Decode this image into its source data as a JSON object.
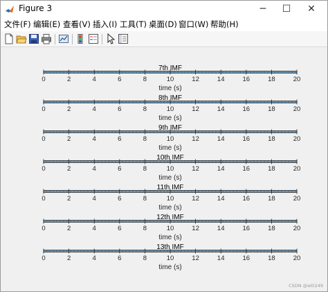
{
  "window": {
    "title": "Figure 3",
    "controls": [
      "─",
      "☐",
      "✕"
    ]
  },
  "menu": [
    "文件(F)",
    "编辑(E)",
    "查看(V)",
    "插入(I)",
    "工具(T)",
    "桌面(D)",
    "窗口(W)",
    "帮助(H)"
  ],
  "toolbar_icons": [
    "new-figure-icon",
    "open-file-icon",
    "save-icon",
    "print-icon",
    "link-plot-icon",
    "colorbar-icon",
    "legend-icon",
    "edit-plot-arrow-icon",
    "property-inspector-icon"
  ],
  "colors": {
    "signal": "#1f5f8b",
    "signal_light": "#6fa9d2",
    "axis": "#262626",
    "figure_bg": "#f0f0f0"
  },
  "chart_data": {
    "type": "line",
    "xlim": [
      0,
      20
    ],
    "xticks": [
      "0",
      "2",
      "4",
      "6",
      "8",
      "10",
      "12",
      "14",
      "16",
      "18",
      "20"
    ],
    "xlabel": "time (s)",
    "subplots": [
      {
        "title": "7th IMF",
        "ylim": [
          -1,
          1
        ],
        "x": [
          0,
          20
        ],
        "y": [
          0,
          0
        ]
      },
      {
        "title": "8th IMF",
        "ylim": [
          -1,
          1
        ],
        "x": [
          0,
          20
        ],
        "y": [
          0,
          0
        ]
      },
      {
        "title": "9th IMF",
        "ylim": [
          -1,
          1
        ],
        "x": [
          0,
          20
        ],
        "y": [
          0,
          0
        ]
      },
      {
        "title": "10th IMF",
        "ylim": [
          -1,
          1
        ],
        "x": [
          0,
          20
        ],
        "y": [
          0,
          0
        ]
      },
      {
        "title": "11th IMF",
        "ylim": [
          -1,
          1
        ],
        "x": [
          0,
          20
        ],
        "y": [
          0,
          0
        ]
      },
      {
        "title": "12th IMF",
        "ylim": [
          -1,
          1
        ],
        "x": [
          0,
          20
        ],
        "y": [
          0,
          0
        ]
      },
      {
        "title": "13th IMF",
        "ylim": [
          -1,
          1
        ],
        "x": [
          0,
          20
        ],
        "y": [
          0,
          0
        ]
      }
    ]
  },
  "watermark": "CSDN @wtt249"
}
